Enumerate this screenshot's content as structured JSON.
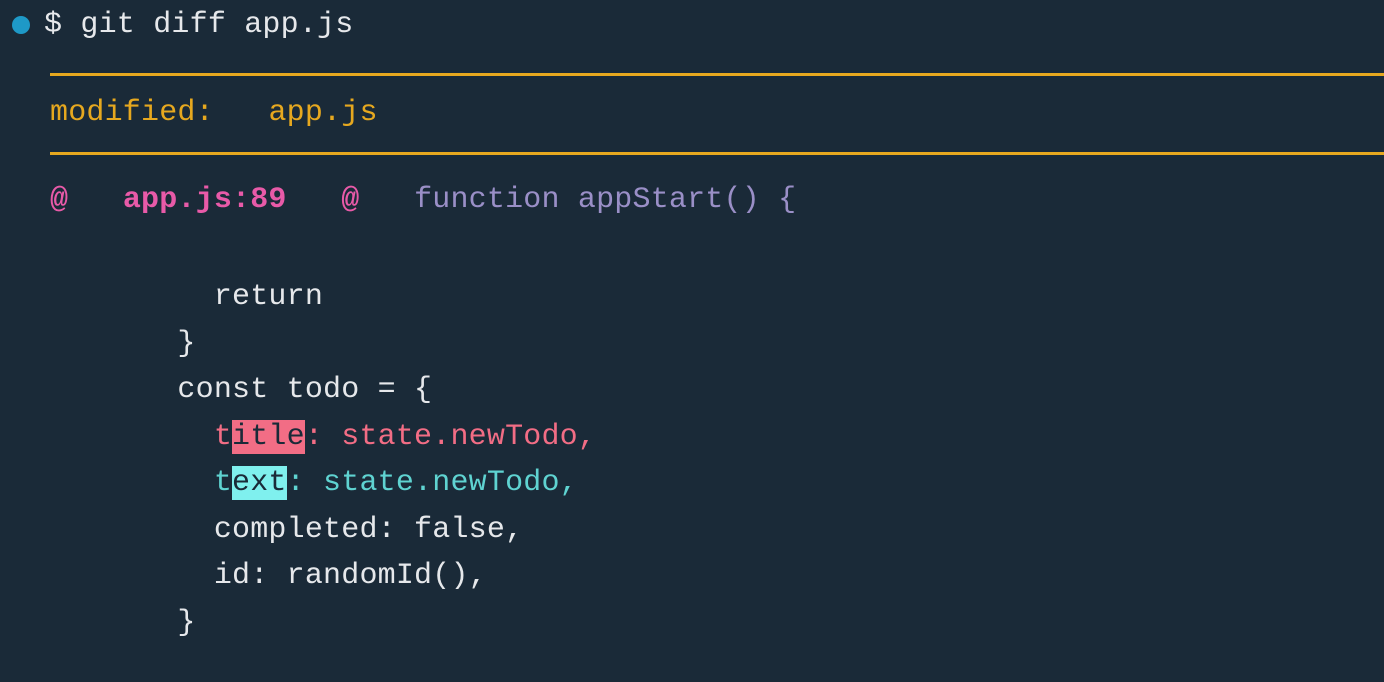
{
  "prompt": {
    "symbol": "$",
    "command": "git diff app.js"
  },
  "status": {
    "label": "modified:",
    "file": "app.js"
  },
  "hunk": {
    "at_open": "@",
    "location": "app.js:89",
    "at_close": "@",
    "context": "function appStart() {"
  },
  "lines": {
    "l1": "         return",
    "l2": "       }",
    "l3": "       const todo = {",
    "removed_prefix": "         t",
    "removed_hl": "itle",
    "removed_suffix": ": state.newTodo,",
    "added_prefix": "         t",
    "added_hl": "ext",
    "added_suffix": ": state.newTodo,",
    "l6": "         completed: false,",
    "l7": "         id: randomId(),",
    "l8": "       }"
  }
}
